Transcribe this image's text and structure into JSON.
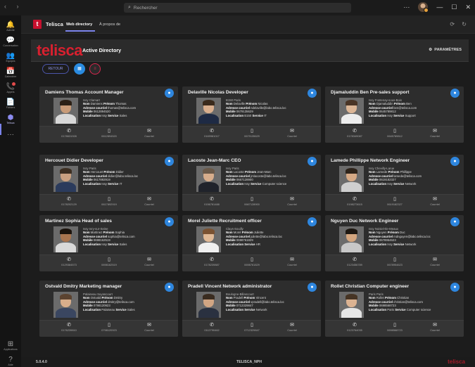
{
  "titlebar": {
    "search_placeholder": "Rechercher",
    "more": "···",
    "min": "—",
    "max": "☐",
    "close": "✕"
  },
  "rail": [
    {
      "icon": "bell-icon",
      "glyph": "🔔",
      "label": "Activité"
    },
    {
      "icon": "chat-icon",
      "glyph": "💬",
      "label": "Conversation"
    },
    {
      "icon": "teams-icon",
      "glyph": "👥",
      "label": "Équipes"
    },
    {
      "icon": "calendar-icon",
      "glyph": "📅",
      "label": "Calendrier"
    },
    {
      "icon": "phone-icon",
      "glyph": "📞",
      "label": "Appels"
    },
    {
      "icon": "file-icon",
      "glyph": "📄",
      "label": "Fichiers"
    },
    {
      "icon": "telisca-icon",
      "glyph": "⬢",
      "label": "Telisca"
    },
    {
      "icon": "more-icon",
      "glyph": "···",
      "label": ""
    },
    {
      "icon": "apps-icon",
      "glyph": "⊞",
      "label": "Applications"
    },
    {
      "icon": "help-icon",
      "glyph": "?",
      "label": "Aide"
    }
  ],
  "header": {
    "logo_letter": "t",
    "app_name": "Telisca",
    "tabs": [
      "Web directory",
      "À propos de"
    ],
    "icons": "⟳ ↻"
  },
  "banner": {
    "brand": "telisca",
    "title": "Active Directory",
    "settings_label": "PARAMÈTRES"
  },
  "toolbar": {
    "back_label": "RETOUR",
    "grid_glyph": "▦",
    "list_glyph": "≡"
  },
  "footer_labels": {
    "mobile": "Courriel"
  },
  "contacts": [
    {
      "title": "Damiens Thomas Account Manager",
      "city": "Issy Clamart",
      "nom": "Damiens",
      "prenom": "Thomas",
      "email": "thomas@telisca.com",
      "mobile": "0612894520",
      "site": "Issy",
      "service": "Sales",
      "phone": "0178631928",
      "phone2": "0612894520",
      "skin": "#c89b78",
      "hair": "#2b2016",
      "shirt": "#d8d8d8"
    },
    {
      "title": "Delaville Nicolas Developer",
      "city": "B150 Paris",
      "nom": "Delaville",
      "prenom": "Nicolas",
      "email": "ndelaville@labo.telisca.loc",
      "mobile": "0679135629",
      "site": "B150",
      "service": "IT",
      "phone": "0169981017",
      "phone2": "0679135629",
      "skin": "#d9ae8d",
      "hair": "#3a2a1c",
      "shirt": "#1e2a44"
    },
    {
      "title": "Djamaluddin Ben Pre-sales support",
      "city": "Issy Fontenay-sous-Bois",
      "nom": "Djamaluddin",
      "prenom": "Ben",
      "email": "ben@telisca.com",
      "mobile": "0645789812",
      "site": "Issy",
      "service": "Support",
      "phone": "0178349087",
      "phone2": "0645789812",
      "skin": "#dcb696",
      "hair": "#4a3526",
      "shirt": "#ededed"
    },
    {
      "title": "Hercouet Didier Developer",
      "city": "Issy Paris",
      "nom": "Hercouet",
      "prenom": "Didier",
      "email": "didier@labo.telisca.loc",
      "mobile": "0617892919",
      "site": "Issy",
      "service": "IT",
      "phone": "0178202129",
      "phone2": "0617892919",
      "skin": "#caa080",
      "hair": "#3d2f22",
      "shirt": "#2b3b5c"
    },
    {
      "title": "Lacoste Jean-Marc CEO",
      "city": "Issy Paris",
      "nom": "Lacoste",
      "prenom": "Jean-Marc",
      "email": "jmlacoste@labo.telisca.loc",
      "mobile": "0667128900",
      "site": "Issy",
      "service": "Computer science",
      "phone": "0156781488",
      "phone2": "0667128900",
      "skin": "#d7ad8c",
      "hair": "#6b5a4a",
      "shirt": "#20232b"
    },
    {
      "title": "Lamede Phillippe Network Engineer",
      "city": "Issy Chevilly-Larue",
      "nom": "Lamede",
      "prenom": "Phillippe",
      "email": "lamede@telisca.com",
      "mobile": "0619182327",
      "site": "Issy",
      "service": "Network",
      "phone": "0198273615",
      "phone2": "0619182327",
      "skin": "#d5a985",
      "hair": "#2e241b",
      "shirt": "#cfcfcf"
    },
    {
      "title": "Martinez Sophia Head of sales",
      "city": "Issy Ivry-sur-Seine",
      "nom": "Martinez",
      "prenom": "Sophia",
      "email": "sophia@telisca.com",
      "mobile": "0698162519",
      "site": "Issy",
      "service": "Sales",
      "phone": "0129384573",
      "phone2": "0698162519",
      "skin": "#a9754f",
      "hair": "#1c140d",
      "shirt": "#d9d9d9"
    },
    {
      "title": "Morel Juliette Recruitment officer",
      "city": "Clays-Souilly",
      "nom": "Morel",
      "prenom": "Juliette",
      "email": "juliette@labo.telisca.loc",
      "mobile": "0698761829",
      "site": "",
      "service": "HR",
      "phone": "0178239887",
      "phone2": "0698761829",
      "skin": "#e0b996",
      "hair": "#7a5232",
      "shirt": "#f0f0f0"
    },
    {
      "title": "Nguyen Duc Network Engineer",
      "city": "Issy Noisiel-Ile-Meaux",
      "nom": "Nguyen",
      "prenom": "Duc",
      "email": "mdnguyen@labo.telisca.loc",
      "mobile": "0678954623",
      "site": "Issy",
      "service": "Network",
      "phone": "0123456789",
      "phone2": "0678954623",
      "skin": "#d3a57e",
      "hair": "#1e1812",
      "shirt": "#c8c8c8"
    },
    {
      "title": "Ostvald Dmitry Marketing manager",
      "city": "Palaiseau Suyancourt",
      "nom": "Ostvald",
      "prenom": "Dmitry",
      "email": "dmitry@telisca.com",
      "mobile": "0798120923",
      "site": "Palaiseau",
      "service": "Sales",
      "phone": "0176239810",
      "phone2": "0798120923",
      "skin": "#d8ae8b",
      "hair": "#5b4330",
      "shirt": "#3a4660"
    },
    {
      "title": "Pradell Vincent Network administrator",
      "city": "Boulogne-Billancourt",
      "nom": "Pradell",
      "prenom": "Vincent",
      "email": "vpradell@labo.telisca.loc",
      "mobile": "0712329847",
      "site": "",
      "service": "Network",
      "phone": "0112790462",
      "phone2": "0712329847",
      "skin": "#d2a683",
      "hair": "#3a2c20",
      "shirt": "#2a3140"
    },
    {
      "title": "Rollet Christian Computer engineer",
      "city": "Paris Paris",
      "nom": "Rollet",
      "prenom": "Christian",
      "email": "christian@telisca.com",
      "mobile": "0698568723",
      "site": "Paris",
      "service": "Computer science",
      "phone": "0123764035",
      "phone2": "0698568723",
      "skin": "#dcb392",
      "hair": "#463424",
      "shirt": "#e6e6e6"
    }
  ],
  "labels": {
    "nom": "Nom",
    "prenom": "Prénom",
    "email": "Adresse courriel",
    "mobile": "Mobile",
    "localisation": "Localisation",
    "service": "Service",
    "courriel": "Courriel"
  },
  "status": {
    "version": "5.0.4.0",
    "center": "TELISCA_NPH",
    "brand": "telisca"
  }
}
